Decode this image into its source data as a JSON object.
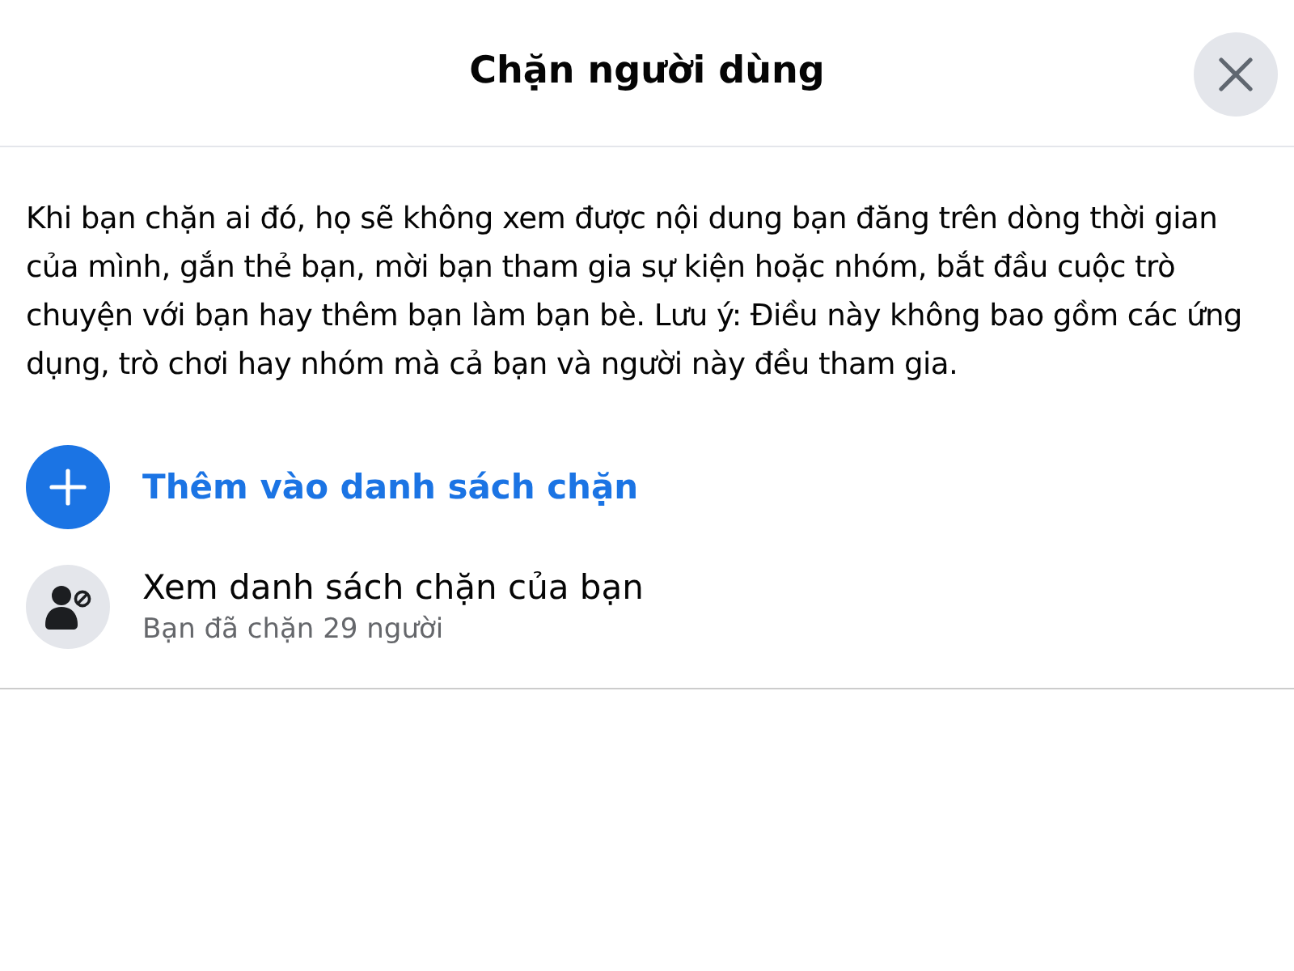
{
  "dialog": {
    "title": "Chặn người dùng",
    "closable": true
  },
  "description": "Khi bạn chặn ai đó, họ sẽ không xem được nội dung bạn đăng trên dòng thời gian của mình, gắn thẻ bạn, mời bạn tham gia sự kiện hoặc nhóm, bắt đầu cuộc trò chuyện với bạn hay thêm bạn làm bạn bè. Lưu ý: Điều này không bao gồm các ứng dụng, trò chơi hay nhóm mà cả bạn và người này đều tham gia.",
  "actions": [
    {
      "kind": "add",
      "label": "Thêm vào danh sách chặn"
    },
    {
      "kind": "view",
      "label": "Xem danh sách chặn của bạn",
      "subtitle": "Bạn đã chặn 29 người"
    }
  ]
}
